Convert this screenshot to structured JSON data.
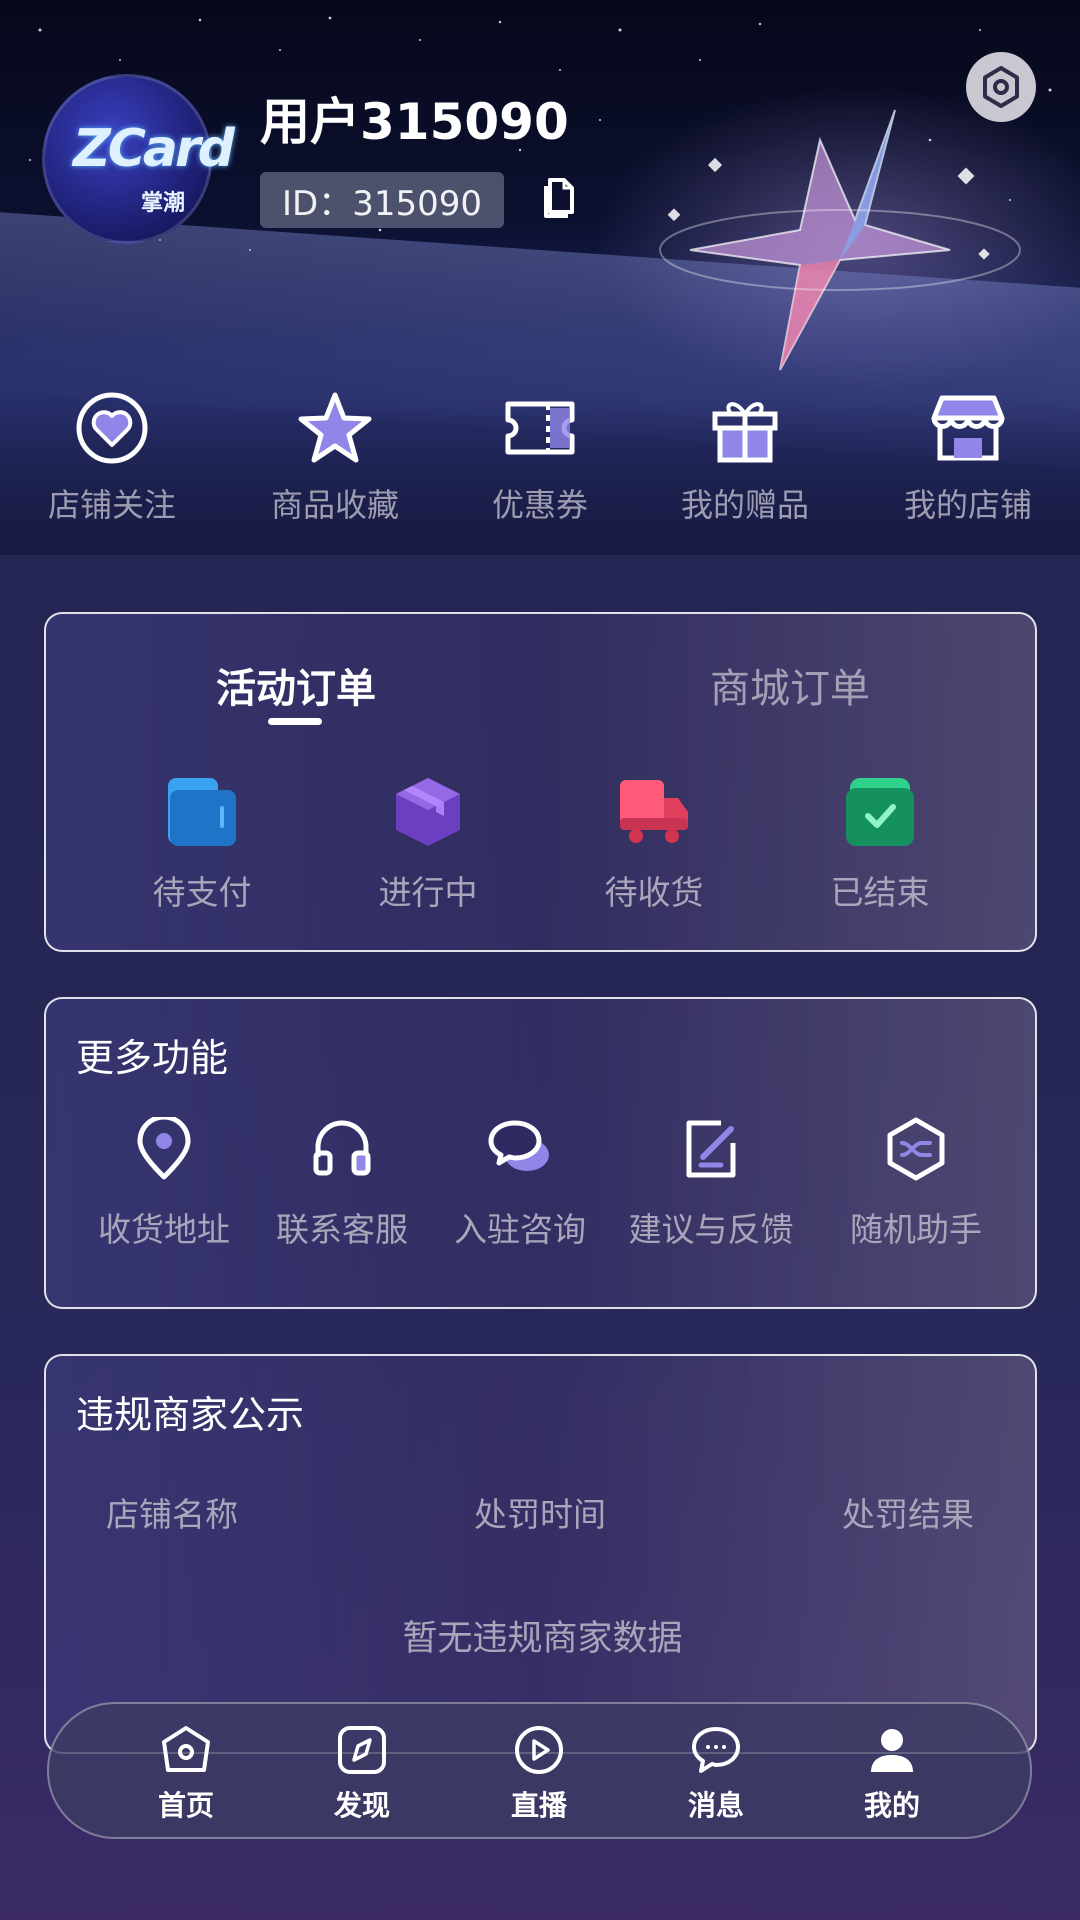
{
  "profile": {
    "username": "用户315090",
    "uid_label": "ID：315090",
    "avatar_brand": "ZCard",
    "avatar_brand_cn": "掌潮"
  },
  "quick_links": [
    {
      "label": "店铺关注",
      "icon": "heart-circle-icon"
    },
    {
      "label": "商品收藏",
      "icon": "star-icon"
    },
    {
      "label": "优惠券",
      "icon": "ticket-icon"
    },
    {
      "label": "我的赠品",
      "icon": "gift-icon"
    },
    {
      "label": "我的店铺",
      "icon": "store-icon"
    }
  ],
  "orders": {
    "tabs": [
      "活动订单",
      "商城订单"
    ],
    "active_tab": "活动订单",
    "statuses": [
      {
        "label": "待支付",
        "icon": "wallet-icon",
        "color": "#2b8be6"
      },
      {
        "label": "进行中",
        "icon": "box-icon",
        "color": "#7a4fd1"
      },
      {
        "label": "待收货",
        "icon": "truck-icon",
        "color": "#f0476a"
      },
      {
        "label": "已结束",
        "icon": "check-bag-icon",
        "color": "#1ea86a"
      }
    ]
  },
  "more_functions": {
    "title": "更多功能",
    "items": [
      {
        "label": "收货地址",
        "icon": "location-icon"
      },
      {
        "label": "联系客服",
        "icon": "headset-icon"
      },
      {
        "label": "入驻咨询",
        "icon": "chat-bubbles-icon"
      },
      {
        "label": "建议与反馈",
        "icon": "edit-icon"
      },
      {
        "label": "随机助手",
        "icon": "shuffle-hex-icon"
      }
    ]
  },
  "violations": {
    "title": "违规商家公示",
    "columns": [
      "店铺名称",
      "处罚时间",
      "处罚结果"
    ],
    "empty_text": "暂无违规商家数据"
  },
  "bottom_nav": [
    {
      "label": "首页",
      "icon": "home-icon"
    },
    {
      "label": "发现",
      "icon": "compass-icon"
    },
    {
      "label": "直播",
      "icon": "play-icon"
    },
    {
      "label": "消息",
      "icon": "message-icon"
    },
    {
      "label": "我的",
      "icon": "user-icon",
      "active": true
    }
  ],
  "colors": {
    "accent": "#8f86e8",
    "background": "#232453"
  }
}
